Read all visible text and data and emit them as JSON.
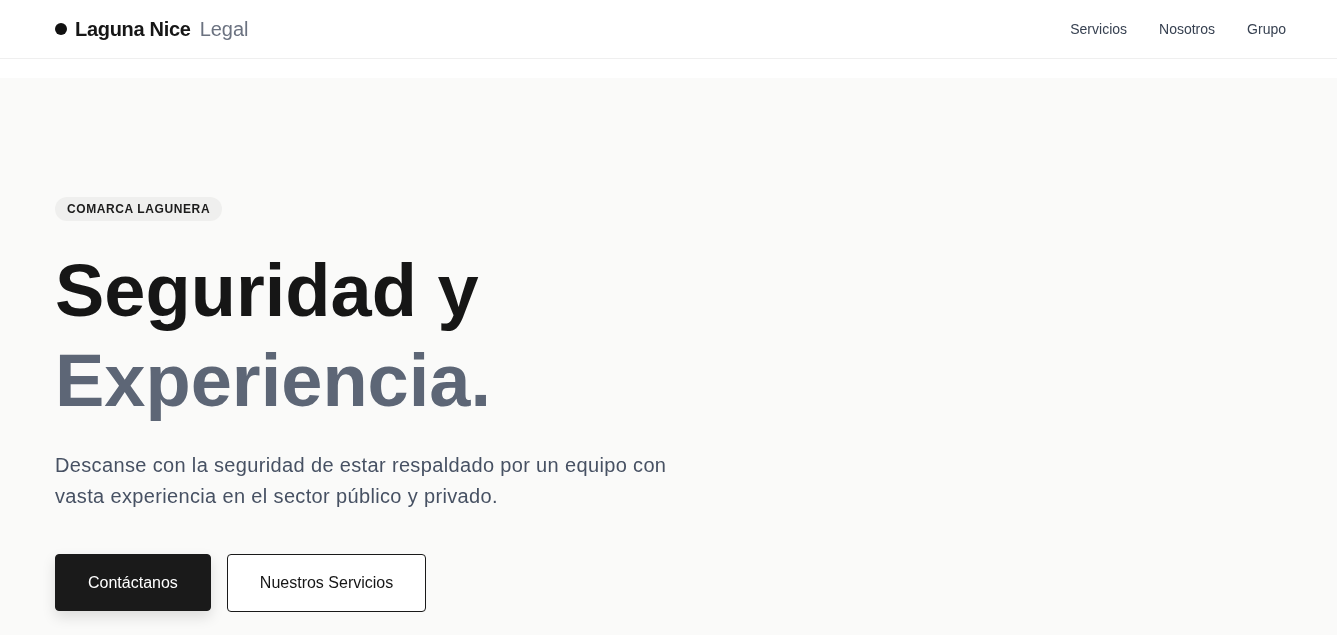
{
  "header": {
    "brand": {
      "name": "Laguna Nice",
      "suffix": "Legal"
    },
    "nav": [
      "Servicios",
      "Nosotros",
      "Grupo"
    ]
  },
  "hero": {
    "badge": "COMARCA LAGUNERA",
    "title_line_1": "Seguridad y",
    "title_line_2": "Experiencia.",
    "description": "Descanse con la seguridad de estar respaldado por un equipo con vasta experiencia en el sector público y privado.",
    "buttons": [
      {
        "label": "Contáctanos",
        "kind": "primary"
      },
      {
        "label": "Nuestros Servicios",
        "kind": "secondary"
      }
    ]
  }
}
